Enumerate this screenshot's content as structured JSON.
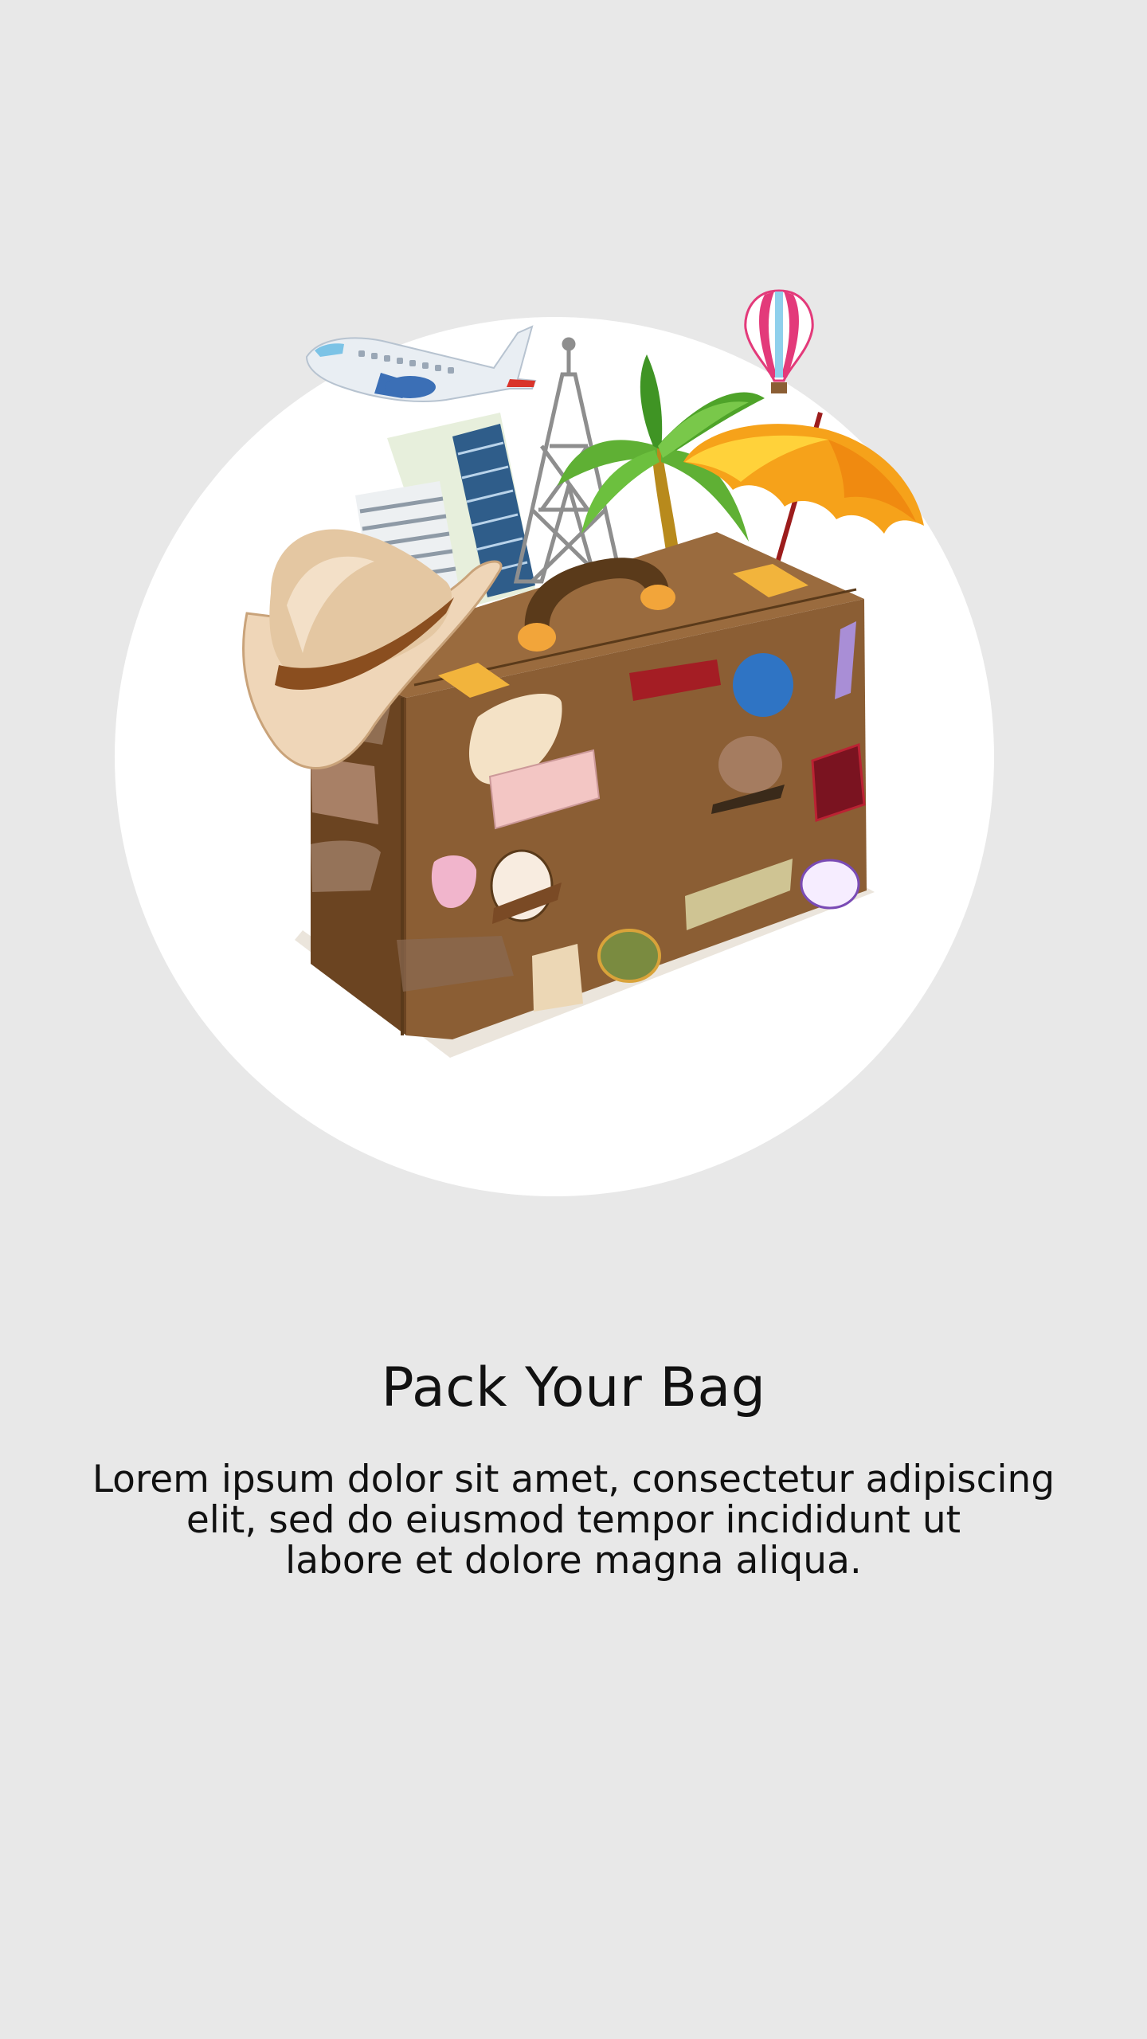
{
  "onboarding": {
    "title": "Pack Your Bag",
    "description": "Lorem ipsum dolor sit amet, consectetur adipiscing\nelit, sed do eiusmod tempor incididunt ut\nlabore et dolore magna aliqua."
  },
  "illustration": {
    "icons": [
      "airplane-icon",
      "hot-air-balloon-icon",
      "buildings-icon",
      "eiffel-tower-icon",
      "palm-tree-icon",
      "umbrella-icon",
      "hat-icon",
      "suitcase-icon"
    ]
  },
  "colors": {
    "background": "#e8e8e8",
    "circle": "#ffffff",
    "suitcase": "#8b5e34",
    "text": "#111111"
  }
}
